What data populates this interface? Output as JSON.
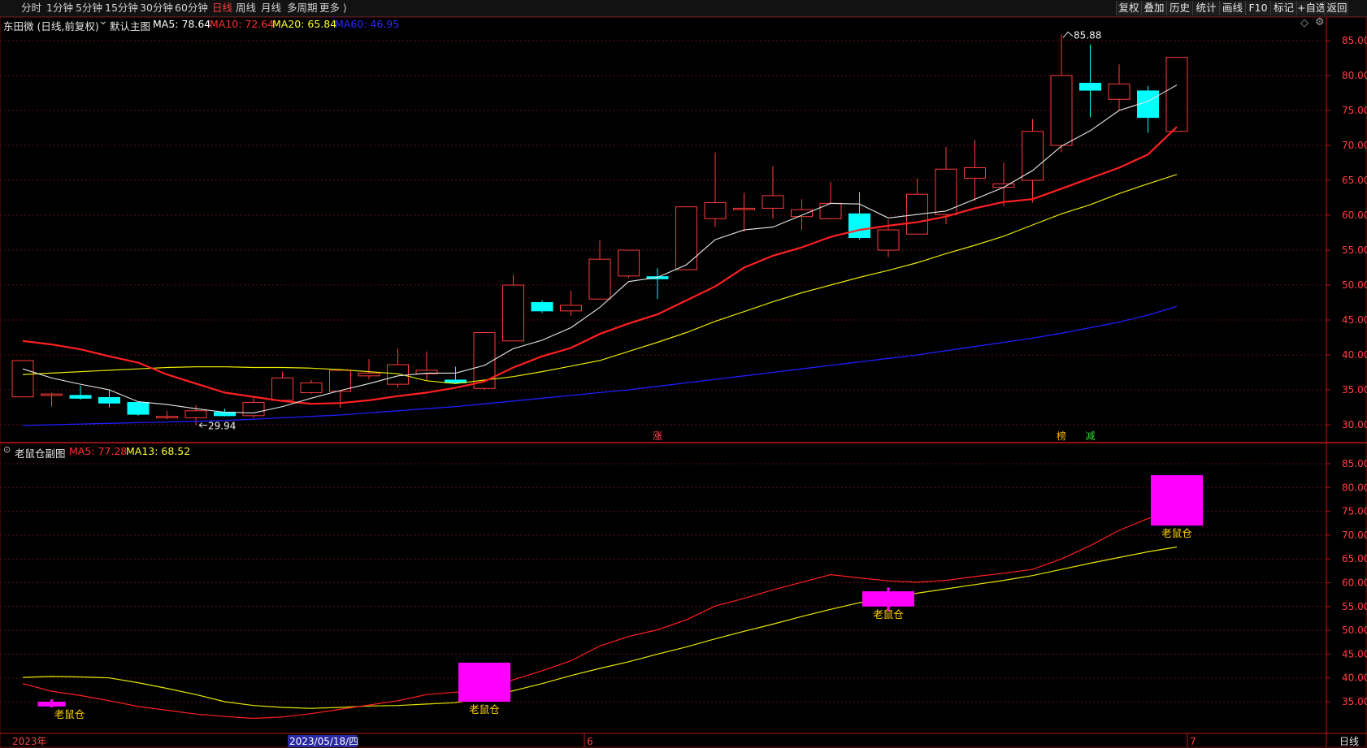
{
  "toolbar": {
    "periods": [
      "分时",
      "1分钟",
      "5分钟",
      "15分钟",
      "30分钟",
      "60分钟",
      "日线",
      "周线",
      "月线",
      "多周期",
      "更多 ⟩"
    ],
    "active_period": "日线",
    "right_buttons": [
      "复权",
      "叠加",
      "历史",
      "统计",
      "画线",
      "F10",
      "标记",
      "+自选",
      "返回"
    ]
  },
  "main_panel": {
    "stock_label": "东田微 (日线,前复权)",
    "template_icon": "chevron-down-icon",
    "template_label": "默认主图",
    "indicators": [
      {
        "text": "MA5: 78.64",
        "color": "#ffffff"
      },
      {
        "text": "MA10: 72.64",
        "color": "#ff3030"
      },
      {
        "text": "MA20: 65.84",
        "color": "#ffff33"
      },
      {
        "text": "MA60: 46.95",
        "color": "#2a2aff"
      }
    ],
    "corner_icon": "diamond-icon",
    "high_label": "85.88",
    "low_label": "29.94",
    "y_ticks": [
      "85.00",
      "80.00",
      "75.00",
      "70.00",
      "65.00",
      "60.00",
      "55.00",
      "50.00",
      "45.00",
      "40.00",
      "35.00",
      "30.00"
    ],
    "markers": [
      {
        "text": "涨",
        "color": "#ff5050"
      },
      {
        "text": "榜",
        "color": "#ffb000"
      },
      {
        "text": "减",
        "color": "#33dd33"
      }
    ]
  },
  "sub_panel": {
    "title": "老鼠仓副图",
    "indicators": [
      {
        "text": "MA5: 77.28",
        "color": "#ff3030"
      },
      {
        "text": "MA13: 68.52",
        "color": "#ffff33"
      }
    ],
    "signal_label": "老鼠仓",
    "y_ticks": [
      "85.00",
      "80.00",
      "75.00",
      "70.00",
      "65.00",
      "60.00",
      "55.00",
      "50.00",
      "45.00",
      "40.00",
      "35.00"
    ]
  },
  "x_axis": {
    "labels": [
      "2023年",
      "2023/05/18/四",
      "6",
      "7"
    ],
    "period_label": "日线"
  },
  "colors": {
    "up": "#ff3b3b",
    "down": "#00ffff",
    "ma5": "#e8e8e8",
    "ma10": "#ff2020",
    "ma20": "#e6e600",
    "ma60": "#1e1eff",
    "signal": "#ff00ff",
    "grid": "#5a1010",
    "axis_text": "#ff4040"
  },
  "chart_data": {
    "type": "candlestick",
    "candles": [
      {
        "o": 34.0,
        "h": 39.2,
        "l": 34.0,
        "c": 39.2
      },
      {
        "o": 34.2,
        "h": 34.6,
        "l": 32.6,
        "c": 34.4
      },
      {
        "o": 34.2,
        "h": 35.6,
        "l": 33.6,
        "c": 33.8
      },
      {
        "o": 33.9,
        "h": 35.0,
        "l": 32.5,
        "c": 33.1
      },
      {
        "o": 33.2,
        "h": 33.3,
        "l": 31.3,
        "c": 31.5
      },
      {
        "o": 31.0,
        "h": 32.0,
        "l": 30.8,
        "c": 31.2
      },
      {
        "o": 31.0,
        "h": 32.8,
        "l": 29.94,
        "c": 32.0
      },
      {
        "o": 31.8,
        "h": 32.3,
        "l": 31.2,
        "c": 31.3
      },
      {
        "o": 31.3,
        "h": 33.8,
        "l": 31.0,
        "c": 33.2
      },
      {
        "o": 33.5,
        "h": 37.6,
        "l": 33.3,
        "c": 36.7
      },
      {
        "o": 34.6,
        "h": 36.4,
        "l": 34.4,
        "c": 36.0
      },
      {
        "o": 34.8,
        "h": 38.0,
        "l": 32.4,
        "c": 37.8
      },
      {
        "o": 37.0,
        "h": 39.4,
        "l": 36.5,
        "c": 37.4
      },
      {
        "o": 35.8,
        "h": 40.9,
        "l": 35.3,
        "c": 38.6
      },
      {
        "o": 37.3,
        "h": 40.5,
        "l": 36.3,
        "c": 37.8
      },
      {
        "o": 36.4,
        "h": 38.3,
        "l": 35.9,
        "c": 36.0
      },
      {
        "o": 35.2,
        "h": 43.2,
        "l": 35.0,
        "c": 43.2
      },
      {
        "o": 42.0,
        "h": 51.5,
        "l": 42.0,
        "c": 50.0
      },
      {
        "o": 47.5,
        "h": 47.8,
        "l": 46.0,
        "c": 46.3
      },
      {
        "o": 46.3,
        "h": 49.2,
        "l": 45.6,
        "c": 47.1
      },
      {
        "o": 48.0,
        "h": 56.4,
        "l": 48.0,
        "c": 53.7
      },
      {
        "o": 51.3,
        "h": 55.0,
        "l": 51.0,
        "c": 55.0
      },
      {
        "o": 51.2,
        "h": 52.4,
        "l": 48.0,
        "c": 50.9
      },
      {
        "o": 52.2,
        "h": 61.2,
        "l": 52.2,
        "c": 61.2
      },
      {
        "o": 59.5,
        "h": 69.0,
        "l": 58.3,
        "c": 61.8
      },
      {
        "o": 60.8,
        "h": 63.2,
        "l": 57.6,
        "c": 61.0
      },
      {
        "o": 61.0,
        "h": 67.0,
        "l": 59.5,
        "c": 62.8
      },
      {
        "o": 59.8,
        "h": 62.3,
        "l": 57.9,
        "c": 60.8
      },
      {
        "o": 59.5,
        "h": 64.8,
        "l": 59.4,
        "c": 61.7
      },
      {
        "o": 60.2,
        "h": 63.3,
        "l": 56.5,
        "c": 56.8
      },
      {
        "o": 55.0,
        "h": 59.3,
        "l": 54.0,
        "c": 57.9
      },
      {
        "o": 57.3,
        "h": 65.3,
        "l": 57.2,
        "c": 63.0
      },
      {
        "o": 60.1,
        "h": 69.8,
        "l": 58.7,
        "c": 66.6
      },
      {
        "o": 65.3,
        "h": 70.8,
        "l": 62.0,
        "c": 66.8
      },
      {
        "o": 64.0,
        "h": 67.5,
        "l": 61.3,
        "c": 64.5
      },
      {
        "o": 65.0,
        "h": 73.8,
        "l": 61.8,
        "c": 72.0
      },
      {
        "o": 70.0,
        "h": 85.88,
        "l": 69.0,
        "c": 80.0
      },
      {
        "o": 78.9,
        "h": 84.4,
        "l": 74.0,
        "c": 77.9
      },
      {
        "o": 76.6,
        "h": 81.6,
        "l": 75.0,
        "c": 78.8
      },
      {
        "o": 77.8,
        "h": 78.5,
        "l": 71.8,
        "c": 74.0
      },
      {
        "o": 72.0,
        "h": 82.6,
        "l": 72.0,
        "c": 82.6
      }
    ],
    "ma5": [
      38.0,
      36.7,
      35.8,
      35.0,
      33.3,
      32.9,
      32.3,
      31.8,
      31.7,
      32.6,
      33.8,
      34.9,
      35.9,
      37.0,
      37.4,
      37.4,
      38.5,
      40.9,
      42.1,
      43.9,
      46.8,
      50.5,
      51.1,
      52.9,
      56.5,
      57.9,
      58.3,
      60.0,
      61.7,
      61.6,
      59.6,
      60.1,
      60.6,
      62.3,
      64.0,
      66.4,
      69.9,
      72.1,
      75.0,
      76.3,
      78.64
    ],
    "ma10": [
      42.0,
      41.5,
      40.8,
      39.8,
      38.9,
      37.2,
      35.9,
      34.6,
      34.0,
      33.4,
      33.0,
      33.1,
      33.5,
      34.1,
      34.6,
      35.3,
      36.2,
      38.2,
      39.8,
      41.0,
      43.0,
      44.5,
      45.8,
      47.8,
      49.8,
      52.5,
      54.2,
      55.4,
      56.9,
      57.9,
      58.5,
      59.0,
      59.8,
      61.0,
      61.9,
      62.3,
      63.8,
      65.3,
      66.8,
      68.7,
      72.64
    ],
    "ma20": [
      37.2,
      37.4,
      37.6,
      37.8,
      38.0,
      38.2,
      38.3,
      38.3,
      38.2,
      38.2,
      38.1,
      37.9,
      37.6,
      37.3,
      36.3,
      35.9,
      36.4,
      36.9,
      37.6,
      38.4,
      39.2,
      40.5,
      41.8,
      43.2,
      44.8,
      46.2,
      47.6,
      48.9,
      50.0,
      51.1,
      52.1,
      53.2,
      54.5,
      55.7,
      57.0,
      58.6,
      60.2,
      61.5,
      63.1,
      64.5,
      65.84
    ],
    "ma60": [
      29.9,
      30.0,
      30.1,
      30.2,
      30.3,
      30.4,
      30.5,
      30.6,
      30.8,
      31.0,
      31.2,
      31.4,
      31.7,
      32.0,
      32.3,
      32.6,
      33.0,
      33.4,
      33.8,
      34.2,
      34.6,
      35.0,
      35.5,
      36.0,
      36.5,
      37.0,
      37.5,
      38.0,
      38.5,
      39.0,
      39.5,
      40.0,
      40.6,
      41.2,
      41.8,
      42.4,
      43.1,
      43.9,
      44.7,
      45.7,
      46.95
    ],
    "high": {
      "index": 36,
      "value": 85.88
    },
    "low": {
      "index": 6,
      "value": 29.94
    },
    "sub_ma5": [
      38.8,
      37.2,
      36.3,
      35.2,
      34.0,
      33.2,
      32.4,
      31.9,
      31.5,
      31.8,
      32.5,
      33.4,
      34.3,
      35.2,
      36.5,
      37.0,
      37.3,
      39.6,
      41.5,
      43.6,
      46.7,
      48.7,
      50.1,
      52.2,
      55.1,
      56.7,
      58.5,
      60.1,
      61.7,
      61.0,
      60.4,
      60.1,
      60.5,
      61.3,
      62.0,
      62.8,
      65.0,
      67.8,
      71.0,
      73.5,
      75.6
    ],
    "sub_ma13": [
      40.1,
      40.3,
      40.2,
      40.0,
      39.0,
      37.8,
      36.5,
      35.0,
      34.2,
      33.8,
      33.6,
      33.8,
      34.1,
      34.2,
      34.5,
      34.8,
      35.9,
      37.3,
      38.8,
      40.5,
      42.0,
      43.4,
      45.0,
      46.5,
      48.2,
      49.8,
      51.3,
      52.9,
      54.4,
      55.8,
      56.8,
      57.8,
      58.7,
      59.6,
      60.5,
      61.5,
      62.8,
      64.1,
      65.3,
      66.5,
      67.5
    ],
    "signals": [
      {
        "index": 1,
        "o": 34.0,
        "c": 35.0,
        "h": 35.5,
        "l": 33.8
      },
      {
        "index": 16,
        "o": 35.0,
        "c": 43.2,
        "h": 43.2,
        "l": 35.0
      },
      {
        "index": 30,
        "o": 55.0,
        "c": 58.2,
        "h": 59.0,
        "l": 54.0
      },
      {
        "index": 40,
        "o": 72.0,
        "c": 82.6,
        "h": 82.6,
        "l": 72.0
      }
    ]
  }
}
